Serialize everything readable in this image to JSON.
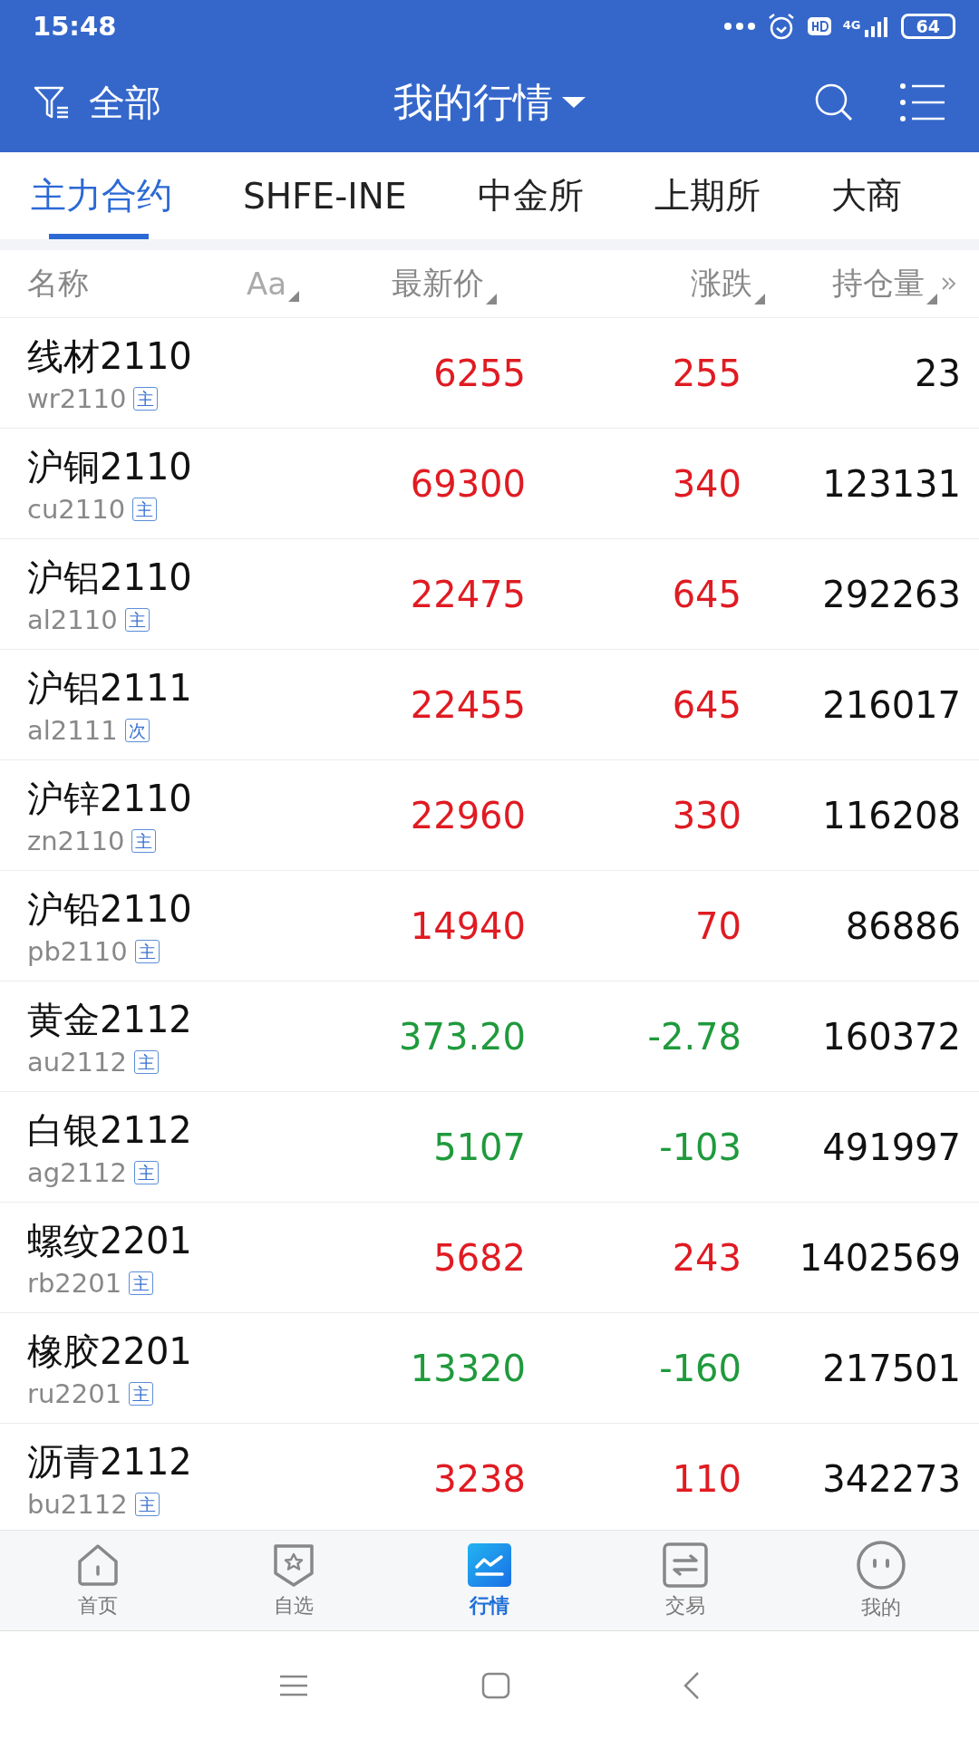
{
  "status_bar": {
    "time": "15:48",
    "network": "4G",
    "battery": "64"
  },
  "header": {
    "filter_label": "全部",
    "title": "我的行情"
  },
  "tabs": [
    {
      "label": "主力合约",
      "selected": true
    },
    {
      "label": "SHFE-INE",
      "selected": false
    },
    {
      "label": "中金所",
      "selected": false
    },
    {
      "label": "上期所",
      "selected": false
    },
    {
      "label": "大商",
      "selected": false
    }
  ],
  "columns": [
    "名称",
    "Aa",
    "最新价",
    "涨跌",
    "持仓量"
  ],
  "rows": [
    {
      "name": "线材2110",
      "code": "wr2110",
      "tag": "主",
      "price": "6255",
      "change": "255",
      "open_interest": "23",
      "color": "#e01b22"
    },
    {
      "name": "沪铜2110",
      "code": "cu2110",
      "tag": "主",
      "price": "69300",
      "change": "340",
      "open_interest": "123131",
      "color": "#e01b22"
    },
    {
      "name": "沪铝2110",
      "code": "al2110",
      "tag": "主",
      "price": "22475",
      "change": "645",
      "open_interest": "292263",
      "color": "#e01b22"
    },
    {
      "name": "沪铝2111",
      "code": "al2111",
      "tag": "次",
      "price": "22455",
      "change": "645",
      "open_interest": "216017",
      "color": "#e01b22"
    },
    {
      "name": "沪锌2110",
      "code": "zn2110",
      "tag": "主",
      "price": "22960",
      "change": "330",
      "open_interest": "116208",
      "color": "#e01b22"
    },
    {
      "name": "沪铅2110",
      "code": "pb2110",
      "tag": "主",
      "price": "14940",
      "change": "70",
      "open_interest": "86886",
      "color": "#e01b22"
    },
    {
      "name": "黄金2112",
      "code": "au2112",
      "tag": "主",
      "price": "373.20",
      "change": "-2.78",
      "open_interest": "160372",
      "color": "#1f9a3c"
    },
    {
      "name": "白银2112",
      "code": "ag2112",
      "tag": "主",
      "price": "5107",
      "change": "-103",
      "open_interest": "491997",
      "color": "#1f9a3c"
    },
    {
      "name": "螺纹2201",
      "code": "rb2201",
      "tag": "主",
      "price": "5682",
      "change": "243",
      "open_interest": "1402569",
      "color": "#e01b22"
    },
    {
      "name": "橡胶2201",
      "code": "ru2201",
      "tag": "主",
      "price": "13320",
      "change": "-160",
      "open_interest": "217501",
      "color": "#1f9a3c"
    },
    {
      "name": "沥青2112",
      "code": "bu2112",
      "tag": "主",
      "price": "3238",
      "change": "110",
      "open_interest": "342273",
      "color": "#e01b22"
    }
  ],
  "bottom_nav": [
    {
      "label": "首页",
      "kind": "home",
      "selected": false
    },
    {
      "label": "自选",
      "kind": "star",
      "selected": false
    },
    {
      "label": "行情",
      "kind": "chart",
      "selected": true
    },
    {
      "label": "交易",
      "kind": "trade",
      "selected": false
    },
    {
      "label": "我的",
      "kind": "me",
      "selected": false
    }
  ]
}
